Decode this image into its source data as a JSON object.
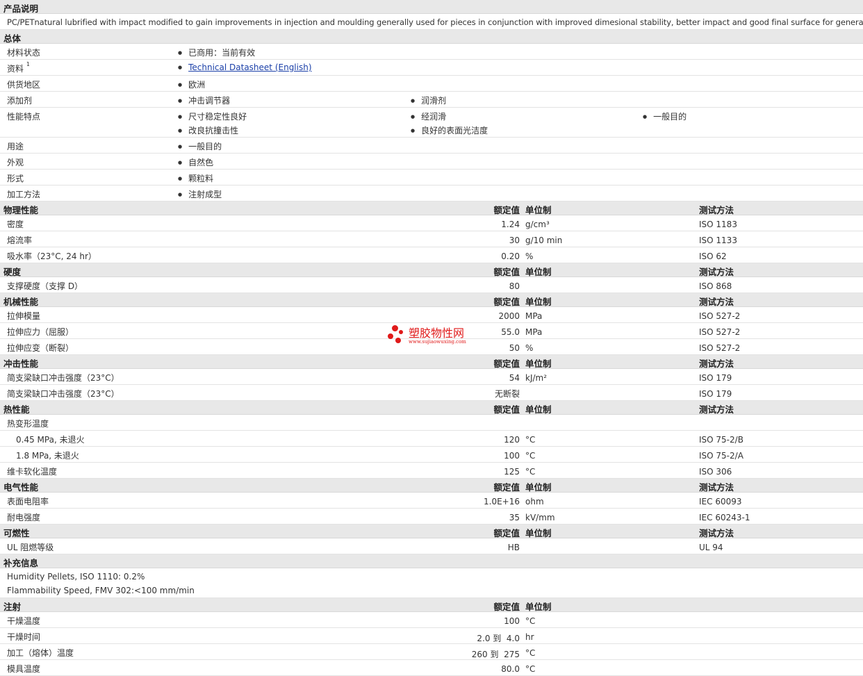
{
  "desc": {
    "title": "产品说明",
    "text": "PC/PETnatural lubrified with impact modified to gain improvements in injection and moulding generally used for pieces in conjunction with improved dimesional stability, better impact and good final surface for general industry."
  },
  "general": {
    "title": "总体",
    "status_label": "材料状态",
    "status": "已商用：当前有效",
    "source_label": "资料",
    "source_sup": "1",
    "source_link": "Technical Datasheet (English)",
    "region_label": "供货地区",
    "region": "欧洲",
    "additive_label": "添加剂",
    "additives": [
      "冲击调节器",
      "润滑剂"
    ],
    "features_label": "性能特点",
    "features": [
      "尺寸稳定性良好",
      "经润滑",
      "一般目的",
      "改良抗撞击性",
      "良好的表面光洁度"
    ],
    "use_label": "用途",
    "use": "一般目的",
    "appearance_label": "外观",
    "appearance": "自然色",
    "form_label": "形式",
    "form": "颗粒料",
    "method_label": "加工方法",
    "method": "注射成型"
  },
  "headers": {
    "value": "额定值",
    "unit": "单位制",
    "test": "测试方法"
  },
  "physical": {
    "title": "物理性能",
    "rows": [
      {
        "label": "密度",
        "value": "1.24",
        "unit": "g/cm³",
        "test": "ISO 1183"
      },
      {
        "label": "熔流率",
        "value": "30",
        "unit": "g/10 min",
        "test": "ISO 1133"
      },
      {
        "label": "吸水率（23°C, 24 hr）",
        "value": "0.20",
        "unit": "%",
        "test": "ISO 62"
      }
    ]
  },
  "hardness": {
    "title": "硬度",
    "rows": [
      {
        "label": "支撑硬度（支撑 D）",
        "value": "80",
        "unit": "",
        "test": "ISO 868"
      }
    ]
  },
  "mechanical": {
    "title": "机械性能",
    "rows": [
      {
        "label": "拉伸模量",
        "value": "2000",
        "unit": "MPa",
        "test": "ISO 527-2"
      },
      {
        "label": "拉伸应力（屈服）",
        "value": "55.0",
        "unit": "MPa",
        "test": "ISO 527-2"
      },
      {
        "label": "拉伸应变（断裂）",
        "value": "50",
        "unit": "%",
        "test": "ISO 527-2"
      }
    ]
  },
  "impact": {
    "title": "冲击性能",
    "rows": [
      {
        "label": "简支梁缺口冲击强度（23°C）",
        "value": "54",
        "unit": "kJ/m²",
        "test": "ISO 179"
      },
      {
        "label": "简支梁缺口冲击强度（23°C）",
        "value": "无断裂",
        "unit": "",
        "test": "ISO 179"
      }
    ]
  },
  "thermal": {
    "title": "热性能",
    "hdt_label": "热变形温度",
    "rows": [
      {
        "label": "0.45 MPa, 未退火",
        "value": "120",
        "unit": "°C",
        "test": "ISO 75-2/B"
      },
      {
        "label": "1.8 MPa, 未退火",
        "value": "100",
        "unit": "°C",
        "test": "ISO 75-2/A"
      },
      {
        "label": "维卡软化温度",
        "value": "125",
        "unit": "°C",
        "test": "ISO 306"
      }
    ]
  },
  "electrical": {
    "title": "电气性能",
    "rows": [
      {
        "label": "表面电阻率",
        "value": "1.0E+16",
        "unit": "ohm",
        "test": "IEC 60093"
      },
      {
        "label": "耐电强度",
        "value": "35",
        "unit": "kV/mm",
        "test": "IEC 60243-1"
      }
    ]
  },
  "flammability": {
    "title": "可燃性",
    "rows": [
      {
        "label": "UL 阻燃等级",
        "value": "HB",
        "unit": "",
        "test": "UL 94"
      }
    ]
  },
  "supplement": {
    "title": "补充信息",
    "notes": [
      "Humidity Pellets, ISO 1110: 0.2%",
      "Flammability Speed, FMV 302:<100 mm/min"
    ]
  },
  "injection": {
    "title": "注射",
    "rows": [
      {
        "label": "干燥温度",
        "value": "100",
        "unit": "°C"
      },
      {
        "label": "干燥时间",
        "value": "2.0 到  4.0",
        "unit": "hr"
      },
      {
        "label": "加工（熔体）温度",
        "value": "260 到  275",
        "unit": "°C"
      },
      {
        "label": "模具温度",
        "value": "80.0",
        "unit": "°C"
      }
    ]
  },
  "watermark": {
    "cn": "塑胶物性网",
    "url": "www.sujiaowuxing.com"
  }
}
